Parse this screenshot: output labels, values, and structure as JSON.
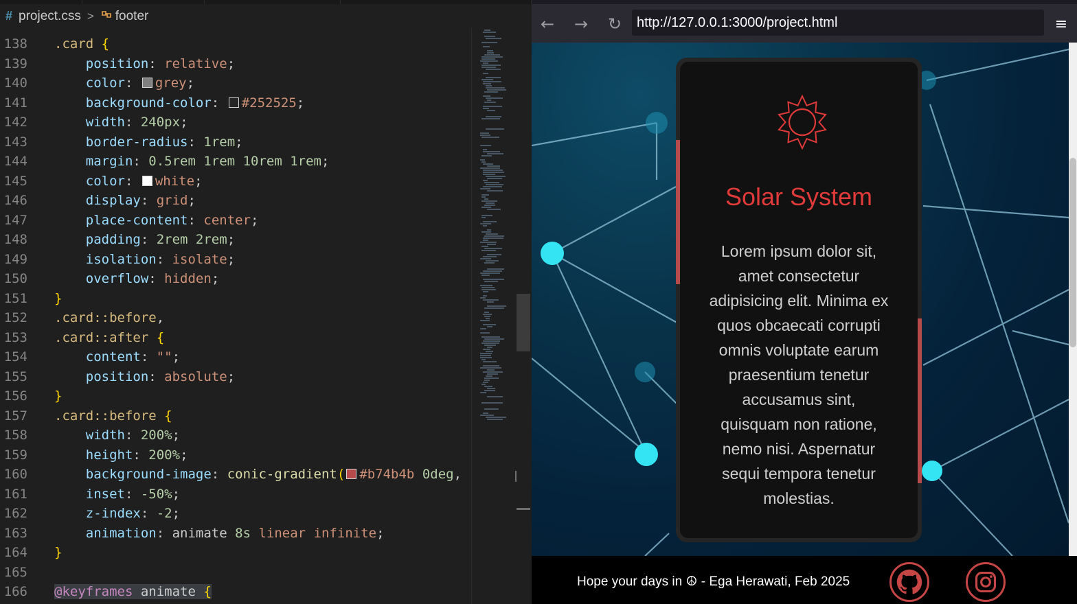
{
  "editor": {
    "breadcrumb": {
      "file_icon": "#",
      "file": "project.css",
      "separator": ">",
      "symbol": "footer"
    },
    "lines": [
      {
        "n": "138"
      },
      {
        "n": "139"
      },
      {
        "n": "140"
      },
      {
        "n": "141"
      },
      {
        "n": "142"
      },
      {
        "n": "143"
      },
      {
        "n": "144"
      },
      {
        "n": "145"
      },
      {
        "n": "146"
      },
      {
        "n": "147"
      },
      {
        "n": "148"
      },
      {
        "n": "149"
      },
      {
        "n": "150"
      },
      {
        "n": "151"
      },
      {
        "n": "152"
      },
      {
        "n": "153"
      },
      {
        "n": "154"
      },
      {
        "n": "155"
      },
      {
        "n": "156"
      },
      {
        "n": "157"
      },
      {
        "n": "158"
      },
      {
        "n": "159"
      },
      {
        "n": "160"
      },
      {
        "n": "161"
      },
      {
        "n": "162"
      },
      {
        "n": "163"
      },
      {
        "n": "164"
      },
      {
        "n": "165"
      },
      {
        "n": "166"
      }
    ],
    "code": {
      "l138": {
        "sel": ".card",
        "brace": "{"
      },
      "l139": {
        "prop": "position",
        "val": "relative"
      },
      "l140": {
        "prop": "color",
        "val": "grey",
        "swatch": "#808080"
      },
      "l141": {
        "prop": "background-color",
        "val": "#252525",
        "swatch": "#252525"
      },
      "l142": {
        "prop": "width",
        "val": "240px"
      },
      "l143": {
        "prop": "border-radius",
        "val": "1rem"
      },
      "l144": {
        "prop": "margin",
        "val": "0.5rem 1rem 10rem 1rem"
      },
      "l145": {
        "prop": "color",
        "val": "white",
        "swatch": "#ffffff"
      },
      "l146": {
        "prop": "display",
        "val": "grid"
      },
      "l147": {
        "prop": "place-content",
        "val": "center"
      },
      "l148": {
        "prop": "padding",
        "val": "2rem 2rem"
      },
      "l149": {
        "prop": "isolation",
        "val": "isolate"
      },
      "l150": {
        "prop": "overflow",
        "val": "hidden"
      },
      "l151": {
        "brace": "}"
      },
      "l152": {
        "sel": ".card::before",
        "tail": ","
      },
      "l153": {
        "sel": ".card::after",
        "brace": "{"
      },
      "l154": {
        "prop": "content",
        "val": "\"\""
      },
      "l155": {
        "prop": "position",
        "val": "absolute"
      },
      "l156": {
        "brace": "}"
      },
      "l157": {
        "sel": ".card::before",
        "brace": "{"
      },
      "l158": {
        "prop": "width",
        "val": "200%"
      },
      "l159": {
        "prop": "height",
        "val": "200%"
      },
      "l160": {
        "prop": "background-image",
        "fn": "conic-gradient",
        "paren": "(",
        "val": "#b74b4b",
        "arg2": "0deg",
        "tail": ",",
        "swatch": "#b74b4b"
      },
      "l161": {
        "prop": "inset",
        "val": "-50%"
      },
      "l162": {
        "prop": "z-index",
        "val": "-2"
      },
      "l163": {
        "prop": "animation",
        "v1": "animate",
        "v2": "8s",
        "v3": "linear",
        "v4": "infinite"
      },
      "l164": {
        "brace": "}"
      },
      "l166": {
        "kw": "@keyframes",
        "name": "animate",
        "brace": "{"
      }
    }
  },
  "browser": {
    "back_icon": "←",
    "forward_icon": "→",
    "reload_icon": "↻",
    "url": "http://127.0.0.1:3000/project.html",
    "menu_icon": "≡",
    "card": {
      "icon": "sun-icon",
      "title": "Solar System",
      "text": "Lorem ipsum dolor sit, amet consectetur adipisicing elit. Minima ex quos obcaecati corrupti omnis voluptate earum praesentium tenetur accusamus sint, quisquam non ratione, nemo nisi. Aspernatur sequi tempora tenetur molestias."
    },
    "footer": {
      "text": "Hope your days in ☮ - Ega Herawati, Feb 2025",
      "github_icon": "github-icon",
      "instagram_icon": "instagram-icon"
    },
    "colors": {
      "accent": "#b74b4b",
      "title": "#e03a3a",
      "card_bg": "#252525"
    }
  }
}
